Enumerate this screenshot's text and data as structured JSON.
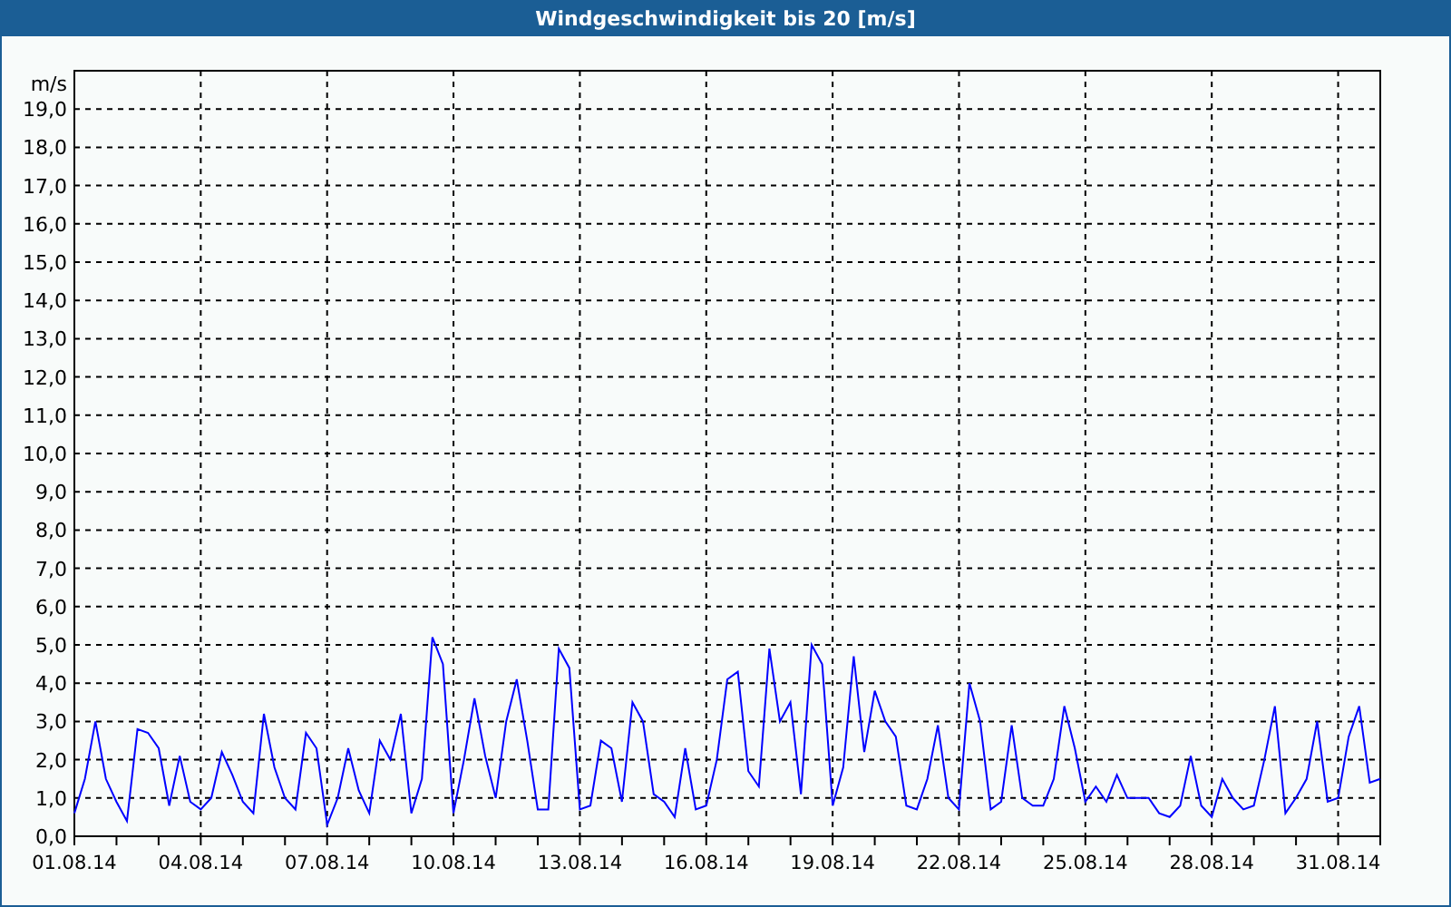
{
  "window": {
    "title": "Windgeschwindigkeit bis 20 [m/s]"
  },
  "chart": {
    "chart_data": {
      "type": "line",
      "ylabel": "m/s",
      "ylim": [
        0,
        20
      ],
      "grid": true,
      "categories": [
        "01.08.14",
        null,
        null,
        null,
        null,
        null,
        null,
        null,
        null,
        null,
        null,
        null,
        "04.08.14",
        null,
        null,
        null,
        null,
        null,
        null,
        null,
        null,
        null,
        null,
        null,
        "07.08.14",
        null,
        null,
        null,
        null,
        null,
        null,
        null,
        null,
        null,
        null,
        null,
        "10.08.14",
        null,
        null,
        null,
        null,
        null,
        null,
        null,
        null,
        null,
        null,
        null,
        "13.08.14",
        null,
        null,
        null,
        null,
        null,
        null,
        null,
        null,
        null,
        null,
        null,
        "16.08.14",
        null,
        null,
        null,
        null,
        null,
        null,
        null,
        null,
        null,
        null,
        null,
        "19.08.14",
        null,
        null,
        null,
        null,
        null,
        null,
        null,
        null,
        null,
        null,
        null,
        "22.08.14",
        null,
        null,
        null,
        null,
        null,
        null,
        null,
        null,
        null,
        null,
        null,
        "25.08.14",
        null,
        null,
        null,
        null,
        null,
        null,
        null,
        null,
        null,
        null,
        null,
        "28.08.14",
        null,
        null,
        null,
        null,
        null,
        null,
        null,
        null,
        null,
        null,
        null,
        "31.08.14",
        null,
        null,
        null,
        null
      ],
      "yticks": [
        {
          "value": 0,
          "label": "0,0"
        },
        {
          "value": 1,
          "label": "1,0"
        },
        {
          "value": 2,
          "label": "2,0"
        },
        {
          "value": 3,
          "label": "3,0"
        },
        {
          "value": 4,
          "label": "4,0"
        },
        {
          "value": 5,
          "label": "5,0"
        },
        {
          "value": 6,
          "label": "6,0"
        },
        {
          "value": 7,
          "label": "7,0"
        },
        {
          "value": 8,
          "label": "8,0"
        },
        {
          "value": 9,
          "label": "9,0"
        },
        {
          "value": 10,
          "label": "10,0"
        },
        {
          "value": 11,
          "label": "11,0"
        },
        {
          "value": 12,
          "label": "12,0"
        },
        {
          "value": 13,
          "label": "13,0"
        },
        {
          "value": 14,
          "label": "14,0"
        },
        {
          "value": 15,
          "label": "15,0"
        },
        {
          "value": 16,
          "label": "16,0"
        },
        {
          "value": 17,
          "label": "17,0"
        },
        {
          "value": 18,
          "label": "18,0"
        },
        {
          "value": 19,
          "label": "19,0"
        }
      ],
      "series": [
        {
          "color": "#0000ff",
          "values": [
            0.6,
            1.5,
            3.0,
            1.5,
            0.9,
            0.4,
            2.8,
            2.7,
            2.3,
            0.8,
            2.1,
            0.9,
            0.7,
            1.0,
            2.2,
            1.6,
            0.9,
            0.6,
            3.2,
            1.8,
            1.0,
            0.7,
            2.7,
            2.3,
            0.3,
            1.0,
            2.3,
            1.2,
            0.6,
            2.5,
            2.0,
            3.2,
            0.6,
            1.5,
            5.2,
            4.5,
            0.6,
            2.0,
            3.6,
            2.1,
            1.0,
            3.0,
            4.1,
            2.5,
            0.7,
            0.7,
            4.9,
            4.4,
            0.7,
            0.8,
            2.5,
            2.3,
            0.9,
            3.5,
            3.0,
            1.1,
            0.9,
            0.5,
            2.3,
            0.7,
            0.8,
            2.0,
            4.1,
            4.3,
            1.7,
            1.3,
            4.9,
            3.0,
            3.5,
            1.1,
            5.0,
            4.5,
            0.8,
            1.8,
            4.7,
            2.2,
            3.8,
            3.0,
            2.6,
            0.8,
            0.7,
            1.5,
            2.9,
            1.0,
            0.7,
            4.0,
            3.0,
            0.7,
            0.9,
            2.9,
            1.0,
            0.8,
            0.8,
            1.5,
            3.4,
            2.3,
            0.9,
            1.3,
            0.9,
            1.6,
            1.0,
            1.0,
            1.0,
            0.6,
            0.5,
            0.8,
            2.1,
            0.8,
            0.5,
            1.5,
            1.0,
            0.7,
            0.8,
            2.0,
            3.4,
            0.6,
            1.0,
            1.5,
            3.0,
            0.9,
            1.0,
            2.6,
            3.4,
            1.4,
            1.5
          ]
        }
      ]
    }
  }
}
